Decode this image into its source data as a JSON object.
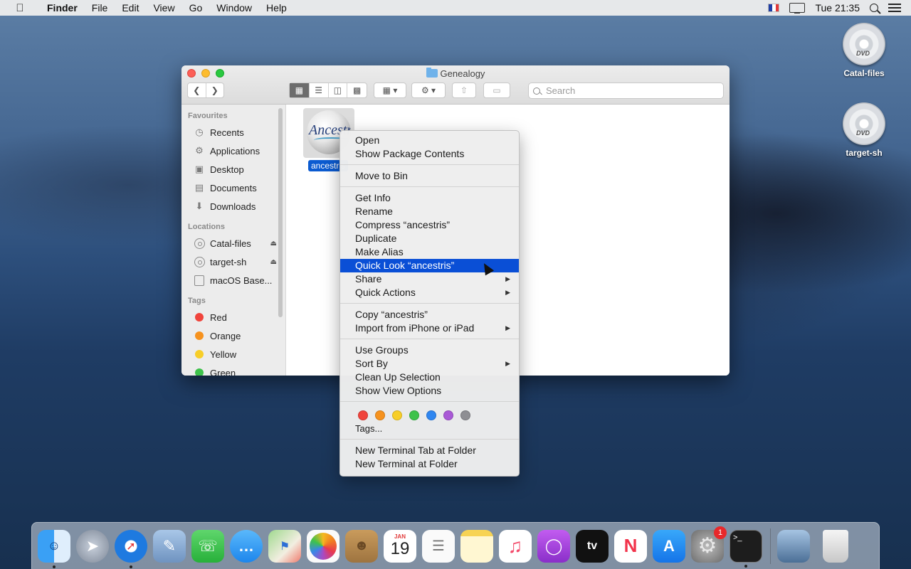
{
  "menubar": {
    "app_name": "Finder",
    "menus": [
      "File",
      "Edit",
      "View",
      "Go",
      "Window",
      "Help"
    ],
    "clock": "Tue 21:35",
    "input_source_flag": "french-flag-icon"
  },
  "desktop_icons": [
    {
      "label": "Catal-files",
      "icon": "dvd-icon"
    },
    {
      "label": "target-sh",
      "icon": "dvd-icon"
    }
  ],
  "finder": {
    "title": "Genealogy",
    "search_placeholder": "Search",
    "sidebar": {
      "favourites_header": "Favourites",
      "favourites": [
        {
          "label": "Recents",
          "icon": "clock-icon"
        },
        {
          "label": "Applications",
          "icon": "applications-icon"
        },
        {
          "label": "Desktop",
          "icon": "desktop-icon"
        },
        {
          "label": "Documents",
          "icon": "document-icon"
        },
        {
          "label": "Downloads",
          "icon": "download-icon"
        }
      ],
      "locations_header": "Locations",
      "locations": [
        {
          "label": "Catal-files",
          "ejectable": true
        },
        {
          "label": "target-sh",
          "ejectable": true
        },
        {
          "label": "macOS Base...",
          "ejectable": false
        }
      ],
      "tags_header": "Tags",
      "tags": [
        {
          "label": "Red",
          "color": "#f0443c"
        },
        {
          "label": "Orange",
          "color": "#f6921e"
        },
        {
          "label": "Yellow",
          "color": "#f7ce28"
        },
        {
          "label": "Green",
          "color": "#3ec24b"
        }
      ]
    },
    "selected_file": {
      "label": "ancestris",
      "logo_text": "Ancestris"
    }
  },
  "context_menu": {
    "groups": [
      [
        {
          "label": "Open"
        },
        {
          "label": "Show Package Contents"
        }
      ],
      [
        {
          "label": "Move to Bin"
        }
      ],
      [
        {
          "label": "Get Info"
        },
        {
          "label": "Rename"
        },
        {
          "label": "Compress “ancestris”"
        },
        {
          "label": "Duplicate"
        },
        {
          "label": "Make Alias"
        },
        {
          "label": "Quick Look “ancestris”",
          "highlighted": true
        },
        {
          "label": "Share",
          "submenu": true
        },
        {
          "label": "Quick Actions",
          "submenu": true
        }
      ],
      [
        {
          "label": "Copy “ancestris”"
        },
        {
          "label": "Import from iPhone or iPad",
          "submenu": true
        }
      ],
      [
        {
          "label": "Use Groups"
        },
        {
          "label": "Sort By",
          "submenu": true
        },
        {
          "label": "Clean Up Selection"
        },
        {
          "label": "Show View Options"
        }
      ]
    ],
    "tag_colors": [
      "#f0443c",
      "#f6921e",
      "#f7ce28",
      "#3ec24b",
      "#2f86f0",
      "#a959d6",
      "#8e8e93"
    ],
    "tags_label": "Tags...",
    "terminal_items": [
      {
        "label": "New Terminal Tab at Folder"
      },
      {
        "label": "New Terminal at Folder"
      }
    ]
  },
  "dock": {
    "apps": [
      {
        "name": "Finder",
        "icon": "finder-icon",
        "color": "#2b8ef0",
        "running": true
      },
      {
        "name": "Launchpad",
        "icon": "rocket-icon",
        "color": "#8a96a8"
      },
      {
        "name": "Safari",
        "icon": "compass-icon",
        "color": "#1e7ae0",
        "running": true
      },
      {
        "name": "Preview",
        "icon": "eagle-icon",
        "color": "#7fa6d0"
      },
      {
        "name": "FaceTime",
        "icon": "video-icon",
        "color": "#36c04a"
      },
      {
        "name": "Messages",
        "icon": "speech-bubble-icon",
        "color": "#2f9bf0"
      },
      {
        "name": "Maps",
        "icon": "map-icon",
        "color": "#7bc26a"
      },
      {
        "name": "Photos",
        "icon": "flower-icon",
        "color": "#f3f3f3"
      },
      {
        "name": "Contacts",
        "icon": "address-book-icon",
        "color": "#b8894e"
      },
      {
        "name": "Calendar",
        "icon": "calendar-icon",
        "color": "#ffffff",
        "month": "JAN",
        "day": "19"
      },
      {
        "name": "Reminders",
        "icon": "list-icon",
        "color": "#f8f8f8"
      },
      {
        "name": "Notes",
        "icon": "notepad-icon",
        "color": "#f7dd6b"
      },
      {
        "name": "Music",
        "icon": "music-note-icon",
        "color": "#f9f9f9"
      },
      {
        "name": "Podcasts",
        "icon": "podcast-icon",
        "color": "#9c3fd8"
      },
      {
        "name": "TV",
        "icon": "tv-icon",
        "color": "#111111",
        "text": "tv"
      },
      {
        "name": "News",
        "icon": "news-icon",
        "color": "#f9f9f9"
      },
      {
        "name": "App Store",
        "icon": "app-store-icon",
        "color": "#1b8cf2"
      },
      {
        "name": "System Preferences",
        "icon": "gear-icon",
        "color": "#8c8c8c",
        "badge": "1"
      },
      {
        "name": "Terminal",
        "icon": "terminal-icon",
        "color": "#222222",
        "running": true
      }
    ],
    "stack_icon": "photo-stack-icon",
    "trash_icon": "trash-icon"
  }
}
